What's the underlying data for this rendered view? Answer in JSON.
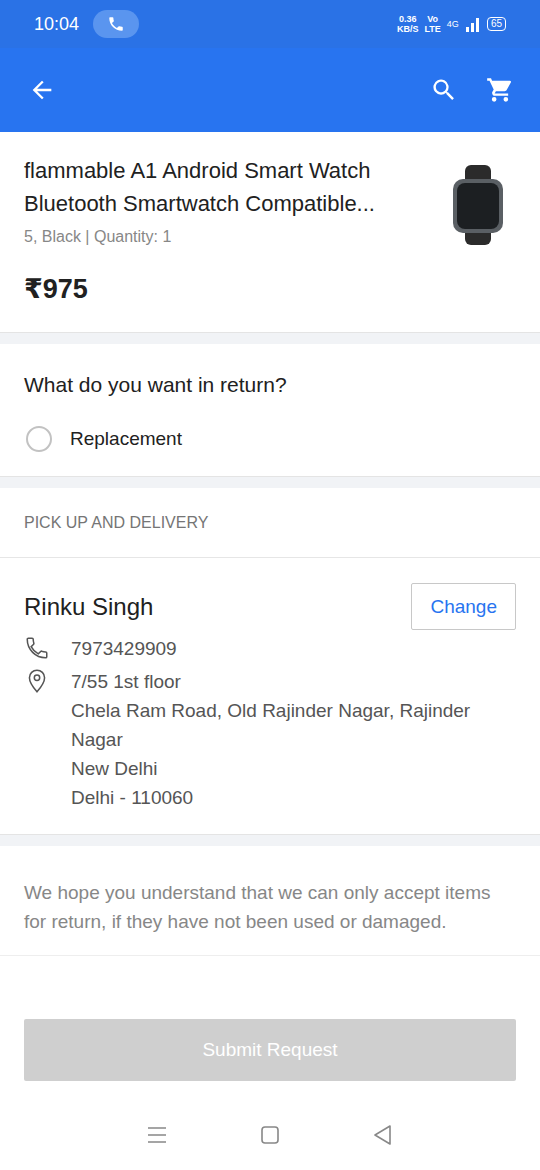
{
  "status_bar": {
    "time": "10:04",
    "speed_value": "0.36",
    "speed_unit": "KB/S",
    "volte_top": "Vo",
    "volte_bottom": "LTE",
    "network": "4G",
    "battery": "65"
  },
  "product": {
    "title": "flammable A1 Android Smart Watch Bluetooth Smartwatch Compatible...",
    "variant": "5, Black | Quantity: 1",
    "price": "₹975"
  },
  "return_options": {
    "question": "What do you want in return?",
    "options": [
      {
        "label": "Replacement",
        "selected": false
      }
    ]
  },
  "pickup": {
    "header": "PICK UP AND DELIVERY",
    "name": "Rinku Singh",
    "change_button": "Change",
    "phone": "7973429909",
    "address_lines": [
      "7/55 1st floor",
      "Chela Ram Road, Old Rajinder Nagar, Rajinder",
      "Nagar",
      "New Delhi",
      "Delhi - 110060"
    ]
  },
  "note": "We hope you understand that we can only accept items for return, if they have not been used or damaged.",
  "submit_button": {
    "label": "Submit Request",
    "disabled": true
  }
}
